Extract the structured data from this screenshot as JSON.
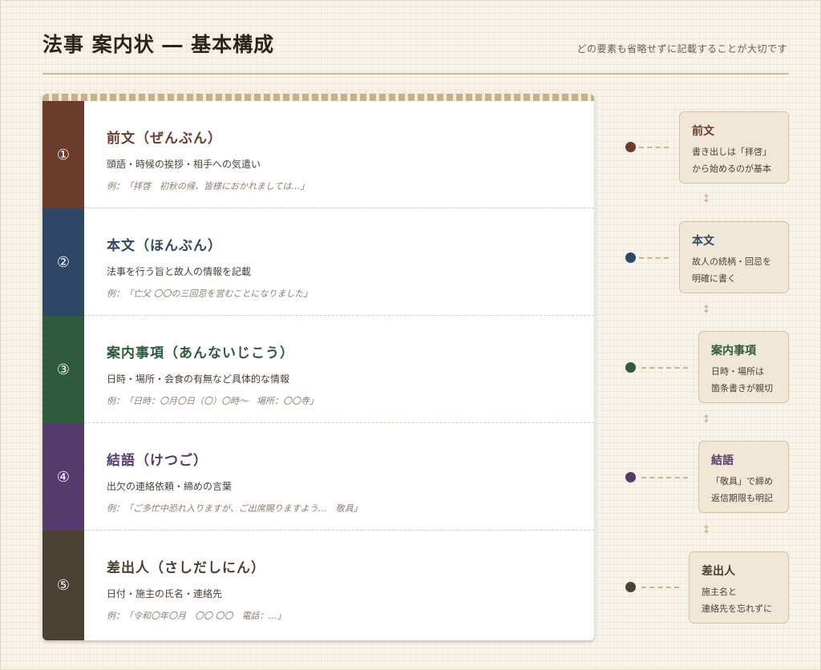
{
  "header": {
    "title": "法事 案内状 ― 基本構成",
    "subtitle": "どの要素も省略せずに記載することが大切です"
  },
  "sections": [
    {
      "num": "①",
      "title": "前文（ぜんぶん）",
      "desc": "頭語・時候の挨拶・相手への気遣い",
      "example": "例：「拝啓　初秋の候、皆様におかれましては…」",
      "color": "#6b3b2c"
    },
    {
      "num": "②",
      "title": "本文（ほんぶん）",
      "desc": "法事を行う旨と故人の情報を記載",
      "example": "例：「亡父 〇〇の三回忌を営むことになりました」",
      "color": "#2f4766"
    },
    {
      "num": "③",
      "title": "案内事項（あんないじこう）",
      "desc": "日時・場所・会食の有無など具体的な情報",
      "example": "例：「日時：〇月〇日（〇）〇時～　場所：〇〇寺」",
      "color": "#2f5a3c"
    },
    {
      "num": "④",
      "title": "結語（けつご）",
      "desc": "出欠の連絡依頼・締めの言葉",
      "example": "例：「ご多忙中恐れ入りますが、ご出席賜りますよう…　敬具」",
      "color": "#553a6b"
    },
    {
      "num": "⑤",
      "title": "差出人（さしだしにん）",
      "desc": "日付・施主の氏名・連絡先",
      "example": "例：「令和〇年〇月　〇〇 〇〇　電話：…」",
      "color": "#4a4133"
    }
  ],
  "flow": [
    {
      "title": "前文",
      "line1": "書き出しは「拝啓」",
      "line2": "から始めるのが基本"
    },
    {
      "title": "本文",
      "line1": "故人の続柄・回忌を",
      "line2": "明確に書く"
    },
    {
      "title": "案内事項",
      "line1": "日時・場所は",
      "line2": "箇条書きが親切"
    },
    {
      "title": "結語",
      "line1": "「敬具」で締め",
      "line2": "返信期限も明記"
    },
    {
      "title": "差出人",
      "line1": "施主名と",
      "line2": "連絡先を忘れずに"
    }
  ],
  "flow_arrow": "↕"
}
